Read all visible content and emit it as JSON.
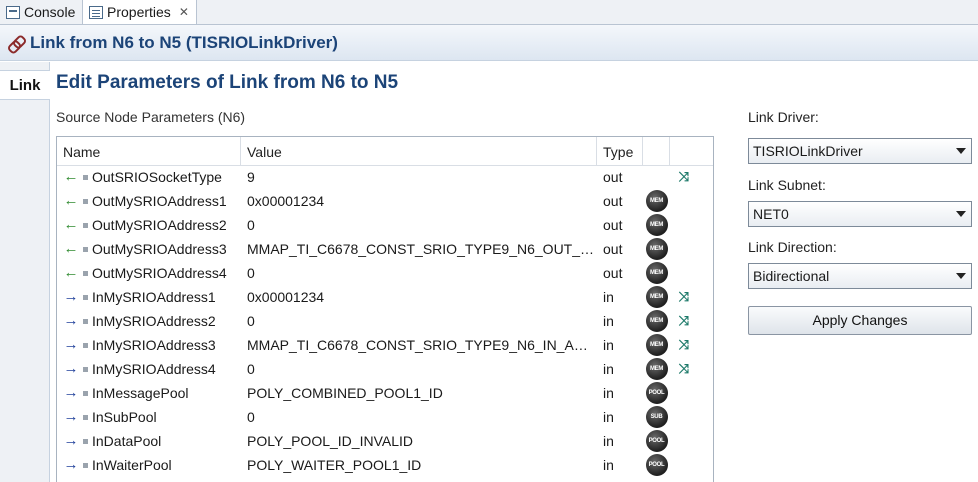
{
  "tabs": [
    {
      "label": "Console",
      "icon": "console-icon"
    },
    {
      "label": "Properties",
      "icon": "properties-icon"
    }
  ],
  "header": {
    "title": "Link from N6 to N5 (TISRIOLinkDriver)"
  },
  "side_tab": {
    "label": "Link"
  },
  "page_title": "Edit Parameters of Link from N6 to N5",
  "section_label": "Source Node Parameters (N6)",
  "table": {
    "columns": [
      "Name",
      "Value",
      "Type"
    ],
    "rows": [
      {
        "direction": "out",
        "name": "OutSRIOSocketType",
        "value": "9",
        "type": "out",
        "badge": "",
        "linked": true
      },
      {
        "direction": "out",
        "name": "OutMySRIOAddress1",
        "value": "0x00001234",
        "type": "out",
        "badge": "MEM",
        "linked": false
      },
      {
        "direction": "out",
        "name": "OutMySRIOAddress2",
        "value": "0",
        "type": "out",
        "badge": "MEM",
        "linked": false
      },
      {
        "direction": "out",
        "name": "OutMySRIOAddress3",
        "value": "MMAP_TI_C6678_CONST_SRIO_TYPE9_N6_OUT_AD...",
        "type": "out",
        "badge": "MEM",
        "linked": false
      },
      {
        "direction": "out",
        "name": "OutMySRIOAddress4",
        "value": "0",
        "type": "out",
        "badge": "MEM",
        "linked": false
      },
      {
        "direction": "in",
        "name": "InMySRIOAddress1",
        "value": "0x00001234",
        "type": "in",
        "badge": "MEM",
        "linked": true
      },
      {
        "direction": "in",
        "name": "InMySRIOAddress2",
        "value": "0",
        "type": "in",
        "badge": "MEM",
        "linked": true
      },
      {
        "direction": "in",
        "name": "InMySRIOAddress3",
        "value": "MMAP_TI_C6678_CONST_SRIO_TYPE9_N6_IN_ADD...",
        "type": "in",
        "badge": "MEM",
        "linked": true
      },
      {
        "direction": "in",
        "name": "InMySRIOAddress4",
        "value": "0",
        "type": "in",
        "badge": "MEM",
        "linked": true
      },
      {
        "direction": "in",
        "name": "InMessagePool",
        "value": "POLY_COMBINED_POOL1_ID",
        "type": "in",
        "badge": "POOL",
        "linked": false
      },
      {
        "direction": "in",
        "name": "InSubPool",
        "value": "0",
        "type": "in",
        "badge": "SUB",
        "linked": false
      },
      {
        "direction": "in",
        "name": "InDataPool",
        "value": "POLY_POOL_ID_INVALID",
        "type": "in",
        "badge": "POOL",
        "linked": false
      },
      {
        "direction": "in",
        "name": "InWaiterPool",
        "value": "POLY_WAITER_POOL1_ID",
        "type": "in",
        "badge": "POOL",
        "linked": false
      }
    ]
  },
  "right_panel": {
    "driver_label": "Link Driver:",
    "driver_value": "TISRIOLinkDriver",
    "subnet_label": "Link Subnet:",
    "subnet_value": "NET0",
    "direction_label": "Link Direction:",
    "direction_value": "Bidirectional",
    "apply_label": "Apply Changes"
  },
  "colors": {
    "title_blue": "#1c4478",
    "out_arrow": "#2f8a2f",
    "in_arrow": "#1e3f9a"
  }
}
